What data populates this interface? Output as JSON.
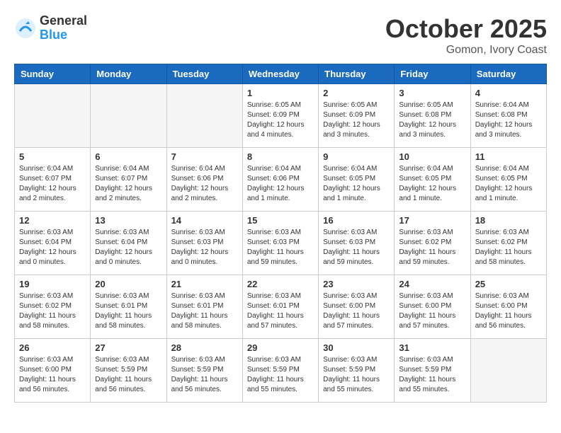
{
  "header": {
    "logo_general": "General",
    "logo_blue": "Blue",
    "month_title": "October 2025",
    "subtitle": "Gomon, Ivory Coast"
  },
  "weekdays": [
    "Sunday",
    "Monday",
    "Tuesday",
    "Wednesday",
    "Thursday",
    "Friday",
    "Saturday"
  ],
  "weeks": [
    [
      {
        "day": "",
        "empty": true
      },
      {
        "day": "",
        "empty": true
      },
      {
        "day": "",
        "empty": true
      },
      {
        "day": "1",
        "info": "Sunrise: 6:05 AM\nSunset: 6:09 PM\nDaylight: 12 hours\nand 4 minutes."
      },
      {
        "day": "2",
        "info": "Sunrise: 6:05 AM\nSunset: 6:09 PM\nDaylight: 12 hours\nand 3 minutes."
      },
      {
        "day": "3",
        "info": "Sunrise: 6:05 AM\nSunset: 6:08 PM\nDaylight: 12 hours\nand 3 minutes."
      },
      {
        "day": "4",
        "info": "Sunrise: 6:04 AM\nSunset: 6:08 PM\nDaylight: 12 hours\nand 3 minutes."
      }
    ],
    [
      {
        "day": "5",
        "info": "Sunrise: 6:04 AM\nSunset: 6:07 PM\nDaylight: 12 hours\nand 2 minutes."
      },
      {
        "day": "6",
        "info": "Sunrise: 6:04 AM\nSunset: 6:07 PM\nDaylight: 12 hours\nand 2 minutes."
      },
      {
        "day": "7",
        "info": "Sunrise: 6:04 AM\nSunset: 6:06 PM\nDaylight: 12 hours\nand 2 minutes."
      },
      {
        "day": "8",
        "info": "Sunrise: 6:04 AM\nSunset: 6:06 PM\nDaylight: 12 hours\nand 1 minute."
      },
      {
        "day": "9",
        "info": "Sunrise: 6:04 AM\nSunset: 6:05 PM\nDaylight: 12 hours\nand 1 minute."
      },
      {
        "day": "10",
        "info": "Sunrise: 6:04 AM\nSunset: 6:05 PM\nDaylight: 12 hours\nand 1 minute."
      },
      {
        "day": "11",
        "info": "Sunrise: 6:04 AM\nSunset: 6:05 PM\nDaylight: 12 hours\nand 1 minute."
      }
    ],
    [
      {
        "day": "12",
        "info": "Sunrise: 6:03 AM\nSunset: 6:04 PM\nDaylight: 12 hours\nand 0 minutes."
      },
      {
        "day": "13",
        "info": "Sunrise: 6:03 AM\nSunset: 6:04 PM\nDaylight: 12 hours\nand 0 minutes."
      },
      {
        "day": "14",
        "info": "Sunrise: 6:03 AM\nSunset: 6:03 PM\nDaylight: 12 hours\nand 0 minutes."
      },
      {
        "day": "15",
        "info": "Sunrise: 6:03 AM\nSunset: 6:03 PM\nDaylight: 11 hours\nand 59 minutes."
      },
      {
        "day": "16",
        "info": "Sunrise: 6:03 AM\nSunset: 6:03 PM\nDaylight: 11 hours\nand 59 minutes."
      },
      {
        "day": "17",
        "info": "Sunrise: 6:03 AM\nSunset: 6:02 PM\nDaylight: 11 hours\nand 59 minutes."
      },
      {
        "day": "18",
        "info": "Sunrise: 6:03 AM\nSunset: 6:02 PM\nDaylight: 11 hours\nand 58 minutes."
      }
    ],
    [
      {
        "day": "19",
        "info": "Sunrise: 6:03 AM\nSunset: 6:02 PM\nDaylight: 11 hours\nand 58 minutes."
      },
      {
        "day": "20",
        "info": "Sunrise: 6:03 AM\nSunset: 6:01 PM\nDaylight: 11 hours\nand 58 minutes."
      },
      {
        "day": "21",
        "info": "Sunrise: 6:03 AM\nSunset: 6:01 PM\nDaylight: 11 hours\nand 58 minutes."
      },
      {
        "day": "22",
        "info": "Sunrise: 6:03 AM\nSunset: 6:01 PM\nDaylight: 11 hours\nand 57 minutes."
      },
      {
        "day": "23",
        "info": "Sunrise: 6:03 AM\nSunset: 6:00 PM\nDaylight: 11 hours\nand 57 minutes."
      },
      {
        "day": "24",
        "info": "Sunrise: 6:03 AM\nSunset: 6:00 PM\nDaylight: 11 hours\nand 57 minutes."
      },
      {
        "day": "25",
        "info": "Sunrise: 6:03 AM\nSunset: 6:00 PM\nDaylight: 11 hours\nand 56 minutes."
      }
    ],
    [
      {
        "day": "26",
        "info": "Sunrise: 6:03 AM\nSunset: 6:00 PM\nDaylight: 11 hours\nand 56 minutes."
      },
      {
        "day": "27",
        "info": "Sunrise: 6:03 AM\nSunset: 5:59 PM\nDaylight: 11 hours\nand 56 minutes."
      },
      {
        "day": "28",
        "info": "Sunrise: 6:03 AM\nSunset: 5:59 PM\nDaylight: 11 hours\nand 56 minutes."
      },
      {
        "day": "29",
        "info": "Sunrise: 6:03 AM\nSunset: 5:59 PM\nDaylight: 11 hours\nand 55 minutes."
      },
      {
        "day": "30",
        "info": "Sunrise: 6:03 AM\nSunset: 5:59 PM\nDaylight: 11 hours\nand 55 minutes."
      },
      {
        "day": "31",
        "info": "Sunrise: 6:03 AM\nSunset: 5:59 PM\nDaylight: 11 hours\nand 55 minutes."
      },
      {
        "day": "",
        "empty": true
      }
    ]
  ]
}
